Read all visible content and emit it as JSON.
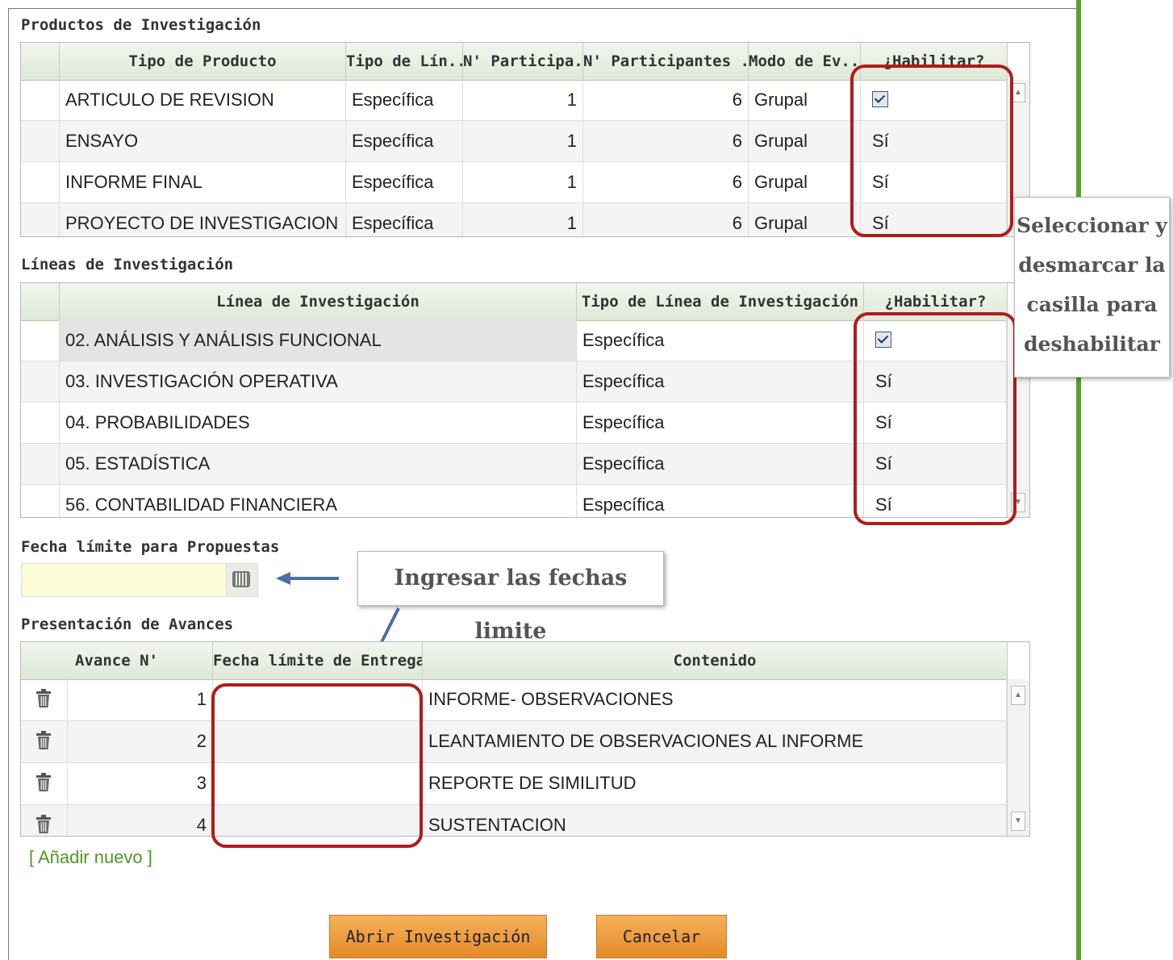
{
  "productos": {
    "title": "Productos de Investigación",
    "columns": [
      "Tipo de Producto",
      "Tipo de Lín...",
      "N' Participa...",
      "N' Participantes ...",
      "Modo de Ev...",
      "¿Habilitar?"
    ],
    "rows": [
      {
        "tipo": "ARTICULO DE REVISION",
        "linea": "Específica",
        "min": "1",
        "max": "6",
        "modo": "Grupal",
        "habilitar": "",
        "checked": true
      },
      {
        "tipo": "ENSAYO",
        "linea": "Específica",
        "min": "1",
        "max": "6",
        "modo": "Grupal",
        "habilitar": "Sí",
        "checked": false
      },
      {
        "tipo": "INFORME FINAL",
        "linea": "Específica",
        "min": "1",
        "max": "6",
        "modo": "Grupal",
        "habilitar": "Sí",
        "checked": false
      },
      {
        "tipo": "PROYECTO DE INVESTIGACION",
        "linea": "Específica",
        "min": "1",
        "max": "6",
        "modo": "Grupal",
        "habilitar": "Sí",
        "checked": false
      }
    ]
  },
  "lineas": {
    "title": "Líneas de Investigación",
    "columns": [
      "Línea de Investigación",
      "Tipo de Línea de Investigación",
      "¿Habilitar?"
    ],
    "rows": [
      {
        "linea": "02. ANÁLISIS Y ANÁLISIS FUNCIONAL",
        "tipo": "Específica",
        "habilitar": "",
        "checked": true
      },
      {
        "linea": "03. INVESTIGACIÓN OPERATIVA",
        "tipo": "Específica",
        "habilitar": "Sí",
        "checked": false
      },
      {
        "linea": "04. PROBABILIDADES",
        "tipo": "Específica",
        "habilitar": "Sí",
        "checked": false
      },
      {
        "linea": "05. ESTADÍSTICA",
        "tipo": "Específica",
        "habilitar": "Sí",
        "checked": false
      },
      {
        "linea": "56. CONTABILIDAD FINANCIERA",
        "tipo": "Específica",
        "habilitar": "Sí",
        "checked": false
      }
    ]
  },
  "fecha_limite": {
    "label": "Fecha límite para Propuestas",
    "value": ""
  },
  "avances": {
    "title": "Presentación de Avances",
    "columns": [
      "Avance N'",
      "Fecha límite de Entrega",
      "Contenido"
    ],
    "rows": [
      {
        "n": "1",
        "fecha": "",
        "contenido": "INFORME- OBSERVACIONES"
      },
      {
        "n": "2",
        "fecha": "",
        "contenido": "LEANTAMIENTO DE OBSERVACIONES AL INFORME"
      },
      {
        "n": "3",
        "fecha": "",
        "contenido": "REPORTE DE SIMILITUD"
      },
      {
        "n": "4",
        "fecha": "",
        "contenido": "SUSTENTACION"
      }
    ]
  },
  "add_link": "[ Añadir nuevo ]",
  "buttons": {
    "abrir": "Abrir Investigación",
    "cancelar": "Cancelar"
  },
  "callouts": {
    "seleccionar": [
      "Seleccionar y",
      "desmarcar la",
      "casilla para",
      "deshabilitar"
    ],
    "ingresar": "Ingresar las fechas limite"
  },
  "icons": {
    "calendar": "calendar-icon",
    "trash": "trash-icon",
    "checkbox": "checkbox-checked",
    "arrow": "arrow-icon"
  },
  "colors": {
    "annotation_red": "#b11b1b",
    "button_orange": "#e48a29",
    "accent_green": "#5aa02c",
    "link_green": "#4d9a22",
    "date_field_yellow": "#fbfbd7"
  }
}
